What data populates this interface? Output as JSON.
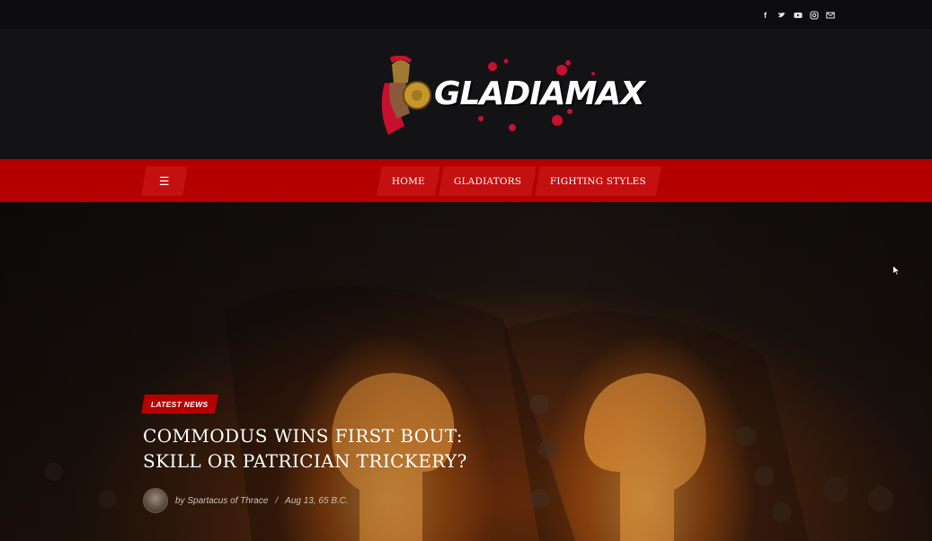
{
  "topbar": {
    "social_icons": [
      "facebook-icon",
      "twitter-icon",
      "youtube-icon",
      "instagram-icon",
      "mail-icon"
    ]
  },
  "header": {
    "logo_text": "GLADIAMAX"
  },
  "nav": {
    "menu_icon": "hamburger-icon",
    "items": [
      {
        "label": "HOME"
      },
      {
        "label": "GLADIATORS"
      },
      {
        "label": "FIGHTING STYLES"
      }
    ]
  },
  "hero": {
    "category": "LATEST NEWS",
    "title_line1": "COMMODUS WINS FIRST BOUT:",
    "title_line2": "SKILL OR PATRICIAN TRICKERY?",
    "author": "by Spartacus of Thrace",
    "separator": "/",
    "date": "Aug 13, 65 B.C."
  },
  "colors": {
    "accent": "#b40000",
    "background": "#131316"
  }
}
